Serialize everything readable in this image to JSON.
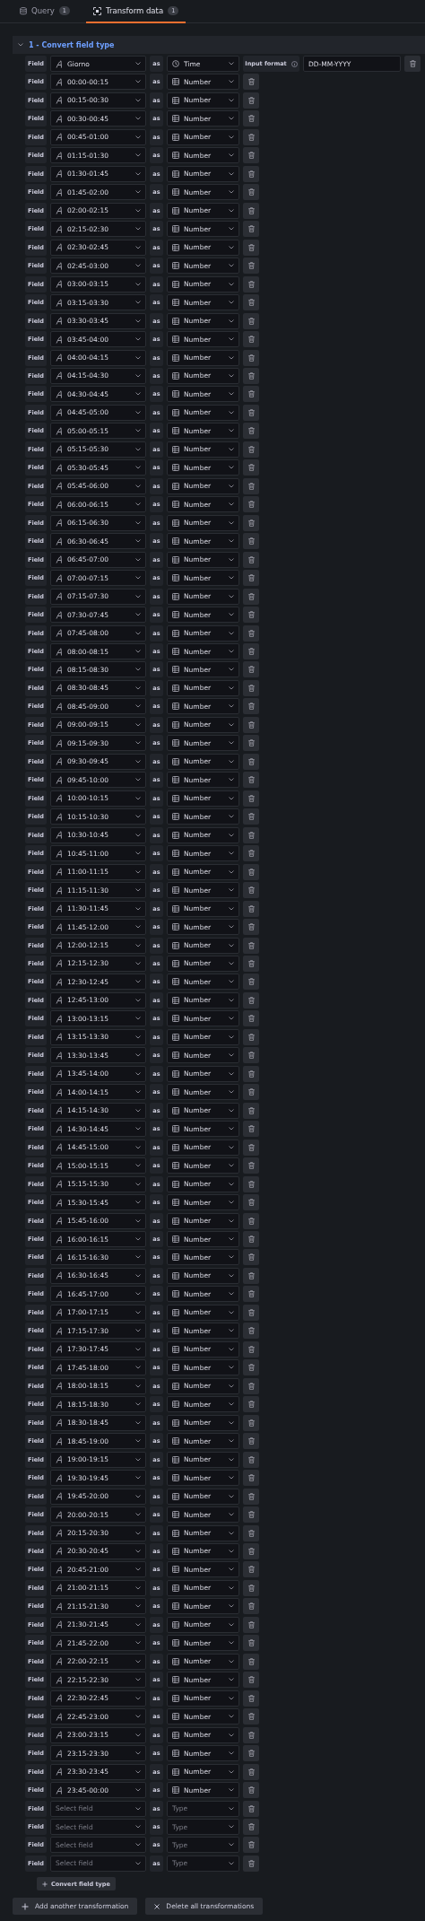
{
  "tabs": [
    {
      "label": "Query",
      "count": "1",
      "kind": "query",
      "selected": false
    },
    {
      "label": "Transform data",
      "count": "1",
      "kind": "transform",
      "selected": true
    }
  ],
  "transformation": {
    "title": "1 - Convert field type",
    "expanded": true,
    "rows": [
      {
        "label": "Field",
        "field": "Giorno",
        "as": "as",
        "type": "Time",
        "kind": "time",
        "input_format_label": "Input format",
        "input_format": "DD-MM-YYYY"
      },
      {
        "label": "Field",
        "field": "00:00-00:15",
        "as": "as",
        "type": "Number",
        "kind": "number"
      },
      {
        "label": "Field",
        "field": "00:15-00:30",
        "as": "as",
        "type": "Number",
        "kind": "number"
      },
      {
        "label": "Field",
        "field": "00:30-00:45",
        "as": "as",
        "type": "Number",
        "kind": "number"
      },
      {
        "label": "Field",
        "field": "00:45-01:00",
        "as": "as",
        "type": "Number",
        "kind": "number"
      },
      {
        "label": "Field",
        "field": "01:15-01:30",
        "as": "as",
        "type": "Number",
        "kind": "number"
      },
      {
        "label": "Field",
        "field": "01:30-01:45",
        "as": "as",
        "type": "Number",
        "kind": "number"
      },
      {
        "label": "Field",
        "field": "01:45-02:00",
        "as": "as",
        "type": "Number",
        "kind": "number"
      },
      {
        "label": "Field",
        "field": "02:00-02:15",
        "as": "as",
        "type": "Number",
        "kind": "number"
      },
      {
        "label": "Field",
        "field": "02:15-02:30",
        "as": "as",
        "type": "Number",
        "kind": "number"
      },
      {
        "label": "Field",
        "field": "02:30-02:45",
        "as": "as",
        "type": "Number",
        "kind": "number"
      },
      {
        "label": "Field",
        "field": "02:45-03:00",
        "as": "as",
        "type": "Number",
        "kind": "number"
      },
      {
        "label": "Field",
        "field": "03:00-03:15",
        "as": "as",
        "type": "Number",
        "kind": "number"
      },
      {
        "label": "Field",
        "field": "03:15-03:30",
        "as": "as",
        "type": "Number",
        "kind": "number"
      },
      {
        "label": "Field",
        "field": "03:30-03:45",
        "as": "as",
        "type": "Number",
        "kind": "number"
      },
      {
        "label": "Field",
        "field": "03:45-04:00",
        "as": "as",
        "type": "Number",
        "kind": "number"
      },
      {
        "label": "Field",
        "field": "04:00-04:15",
        "as": "as",
        "type": "Number",
        "kind": "number"
      },
      {
        "label": "Field",
        "field": "04:15-04:30",
        "as": "as",
        "type": "Number",
        "kind": "number"
      },
      {
        "label": "Field",
        "field": "04:30-04:45",
        "as": "as",
        "type": "Number",
        "kind": "number"
      },
      {
        "label": "Field",
        "field": "04:45-05:00",
        "as": "as",
        "type": "Number",
        "kind": "number"
      },
      {
        "label": "Field",
        "field": "05:00-05:15",
        "as": "as",
        "type": "Number",
        "kind": "number"
      },
      {
        "label": "Field",
        "field": "05:15-05:30",
        "as": "as",
        "type": "Number",
        "kind": "number"
      },
      {
        "label": "Field",
        "field": "05:30-05:45",
        "as": "as",
        "type": "Number",
        "kind": "number"
      },
      {
        "label": "Field",
        "field": "05:45-06:00",
        "as": "as",
        "type": "Number",
        "kind": "number"
      },
      {
        "label": "Field",
        "field": "06:00-06:15",
        "as": "as",
        "type": "Number",
        "kind": "number"
      },
      {
        "label": "Field",
        "field": "06:15-06:30",
        "as": "as",
        "type": "Number",
        "kind": "number"
      },
      {
        "label": "Field",
        "field": "06:30-06:45",
        "as": "as",
        "type": "Number",
        "kind": "number"
      },
      {
        "label": "Field",
        "field": "06:45-07:00",
        "as": "as",
        "type": "Number",
        "kind": "number"
      },
      {
        "label": "Field",
        "field": "07:00-07:15",
        "as": "as",
        "type": "Number",
        "kind": "number"
      },
      {
        "label": "Field",
        "field": "07:15-07:30",
        "as": "as",
        "type": "Number",
        "kind": "number"
      },
      {
        "label": "Field",
        "field": "07:30-07:45",
        "as": "as",
        "type": "Number",
        "kind": "number"
      },
      {
        "label": "Field",
        "field": "07:45-08:00",
        "as": "as",
        "type": "Number",
        "kind": "number"
      },
      {
        "label": "Field",
        "field": "08:00-08:15",
        "as": "as",
        "type": "Number",
        "kind": "number"
      },
      {
        "label": "Field",
        "field": "08:15-08:30",
        "as": "as",
        "type": "Number",
        "kind": "number"
      },
      {
        "label": "Field",
        "field": "08:30-08:45",
        "as": "as",
        "type": "Number",
        "kind": "number"
      },
      {
        "label": "Field",
        "field": "08:45-09:00",
        "as": "as",
        "type": "Number",
        "kind": "number"
      },
      {
        "label": "Field",
        "field": "09:00-09:15",
        "as": "as",
        "type": "Number",
        "kind": "number"
      },
      {
        "label": "Field",
        "field": "09:15-09:30",
        "as": "as",
        "type": "Number",
        "kind": "number"
      },
      {
        "label": "Field",
        "field": "09:30-09:45",
        "as": "as",
        "type": "Number",
        "kind": "number"
      },
      {
        "label": "Field",
        "field": "09:45-10:00",
        "as": "as",
        "type": "Number",
        "kind": "number"
      },
      {
        "label": "Field",
        "field": "10:00-10:15",
        "as": "as",
        "type": "Number",
        "kind": "number"
      },
      {
        "label": "Field",
        "field": "10:15-10:30",
        "as": "as",
        "type": "Number",
        "kind": "number"
      },
      {
        "label": "Field",
        "field": "10:30-10:45",
        "as": "as",
        "type": "Number",
        "kind": "number"
      },
      {
        "label": "Field",
        "field": "10:45-11:00",
        "as": "as",
        "type": "Number",
        "kind": "number"
      },
      {
        "label": "Field",
        "field": "11:00-11:15",
        "as": "as",
        "type": "Number",
        "kind": "number"
      },
      {
        "label": "Field",
        "field": "11:15-11:30",
        "as": "as",
        "type": "Number",
        "kind": "number"
      },
      {
        "label": "Field",
        "field": "11:30-11:45",
        "as": "as",
        "type": "Number",
        "kind": "number"
      },
      {
        "label": "Field",
        "field": "11:45-12:00",
        "as": "as",
        "type": "Number",
        "kind": "number"
      },
      {
        "label": "Field",
        "field": "12:00-12:15",
        "as": "as",
        "type": "Number",
        "kind": "number"
      },
      {
        "label": "Field",
        "field": "12:15-12:30",
        "as": "as",
        "type": "Number",
        "kind": "number"
      },
      {
        "label": "Field",
        "field": "12:30-12:45",
        "as": "as",
        "type": "Number",
        "kind": "number"
      },
      {
        "label": "Field",
        "field": "12:45-13:00",
        "as": "as",
        "type": "Number",
        "kind": "number"
      },
      {
        "label": "Field",
        "field": "13:00-13:15",
        "as": "as",
        "type": "Number",
        "kind": "number"
      },
      {
        "label": "Field",
        "field": "13:15-13:30",
        "as": "as",
        "type": "Number",
        "kind": "number"
      },
      {
        "label": "Field",
        "field": "13:30-13:45",
        "as": "as",
        "type": "Number",
        "kind": "number"
      },
      {
        "label": "Field",
        "field": "13:45-14:00",
        "as": "as",
        "type": "Number",
        "kind": "number"
      },
      {
        "label": "Field",
        "field": "14:00-14:15",
        "as": "as",
        "type": "Number",
        "kind": "number"
      },
      {
        "label": "Field",
        "field": "14:15-14:30",
        "as": "as",
        "type": "Number",
        "kind": "number"
      },
      {
        "label": "Field",
        "field": "14:30-14:45",
        "as": "as",
        "type": "Number",
        "kind": "number"
      },
      {
        "label": "Field",
        "field": "14:45-15:00",
        "as": "as",
        "type": "Number",
        "kind": "number"
      },
      {
        "label": "Field",
        "field": "15:00-15:15",
        "as": "as",
        "type": "Number",
        "kind": "number"
      },
      {
        "label": "Field",
        "field": "15:15-15:30",
        "as": "as",
        "type": "Number",
        "kind": "number"
      },
      {
        "label": "Field",
        "field": "15:30-15:45",
        "as": "as",
        "type": "Number",
        "kind": "number"
      },
      {
        "label": "Field",
        "field": "15:45-16:00",
        "as": "as",
        "type": "Number",
        "kind": "number"
      },
      {
        "label": "Field",
        "field": "16:00-16:15",
        "as": "as",
        "type": "Number",
        "kind": "number"
      },
      {
        "label": "Field",
        "field": "16:15-16:30",
        "as": "as",
        "type": "Number",
        "kind": "number"
      },
      {
        "label": "Field",
        "field": "16:30-16:45",
        "as": "as",
        "type": "Number",
        "kind": "number"
      },
      {
        "label": "Field",
        "field": "16:45-17:00",
        "as": "as",
        "type": "Number",
        "kind": "number"
      },
      {
        "label": "Field",
        "field": "17:00-17:15",
        "as": "as",
        "type": "Number",
        "kind": "number"
      },
      {
        "label": "Field",
        "field": "17:15-17:30",
        "as": "as",
        "type": "Number",
        "kind": "number"
      },
      {
        "label": "Field",
        "field": "17:30-17:45",
        "as": "as",
        "type": "Number",
        "kind": "number"
      },
      {
        "label": "Field",
        "field": "17:45-18:00",
        "as": "as",
        "type": "Number",
        "kind": "number"
      },
      {
        "label": "Field",
        "field": "18:00-18:15",
        "as": "as",
        "type": "Number",
        "kind": "number"
      },
      {
        "label": "Field",
        "field": "18:15-18:30",
        "as": "as",
        "type": "Number",
        "kind": "number"
      },
      {
        "label": "Field",
        "field": "18:30-18:45",
        "as": "as",
        "type": "Number",
        "kind": "number"
      },
      {
        "label": "Field",
        "field": "18:45-19:00",
        "as": "as",
        "type": "Number",
        "kind": "number"
      },
      {
        "label": "Field",
        "field": "19:00-19:15",
        "as": "as",
        "type": "Number",
        "kind": "number"
      },
      {
        "label": "Field",
        "field": "19:30-19:45",
        "as": "as",
        "type": "Number",
        "kind": "number"
      },
      {
        "label": "Field",
        "field": "19:45-20:00",
        "as": "as",
        "type": "Number",
        "kind": "number"
      },
      {
        "label": "Field",
        "field": "20:00-20:15",
        "as": "as",
        "type": "Number",
        "kind": "number"
      },
      {
        "label": "Field",
        "field": "20:15-20:30",
        "as": "as",
        "type": "Number",
        "kind": "number"
      },
      {
        "label": "Field",
        "field": "20:30-20:45",
        "as": "as",
        "type": "Number",
        "kind": "number"
      },
      {
        "label": "Field",
        "field": "20:45-21:00",
        "as": "as",
        "type": "Number",
        "kind": "number"
      },
      {
        "label": "Field",
        "field": "21:00-21:15",
        "as": "as",
        "type": "Number",
        "kind": "number"
      },
      {
        "label": "Field",
        "field": "21:15-21:30",
        "as": "as",
        "type": "Number",
        "kind": "number"
      },
      {
        "label": "Field",
        "field": "21:30-21:45",
        "as": "as",
        "type": "Number",
        "kind": "number"
      },
      {
        "label": "Field",
        "field": "21:45-22:00",
        "as": "as",
        "type": "Number",
        "kind": "number"
      },
      {
        "label": "Field",
        "field": "22:00-22:15",
        "as": "as",
        "type": "Number",
        "kind": "number"
      },
      {
        "label": "Field",
        "field": "22:15-22:30",
        "as": "as",
        "type": "Number",
        "kind": "number"
      },
      {
        "label": "Field",
        "field": "22:30-22:45",
        "as": "as",
        "type": "Number",
        "kind": "number"
      },
      {
        "label": "Field",
        "field": "22:45-23:00",
        "as": "as",
        "type": "Number",
        "kind": "number"
      },
      {
        "label": "Field",
        "field": "23:00-23:15",
        "as": "as",
        "type": "Number",
        "kind": "number"
      },
      {
        "label": "Field",
        "field": "23:15-23:30",
        "as": "as",
        "type": "Number",
        "kind": "number"
      },
      {
        "label": "Field",
        "field": "23:30-23:45",
        "as": "as",
        "type": "Number",
        "kind": "number"
      },
      {
        "label": "Field",
        "field": "23:45-00:00",
        "as": "as",
        "type": "Number",
        "kind": "number"
      },
      {
        "label": "Field",
        "field_placeholder": "Select field",
        "as": "as",
        "type_placeholder": "Type",
        "kind": "empty"
      },
      {
        "label": "Field",
        "field_placeholder": "Select field",
        "as": "as",
        "type_placeholder": "Type",
        "kind": "empty"
      },
      {
        "label": "Field",
        "field_placeholder": "Select field",
        "as": "as",
        "type_placeholder": "Type",
        "kind": "empty"
      },
      {
        "label": "Field",
        "field_placeholder": "Select field",
        "as": "as",
        "type_placeholder": "Type",
        "kind": "empty"
      }
    ],
    "add_button": "Convert field type"
  },
  "buttons": [
    {
      "label": "Add another transformation",
      "kind": "add"
    },
    {
      "label": "Delete all transformations",
      "kind": "delete"
    }
  ]
}
